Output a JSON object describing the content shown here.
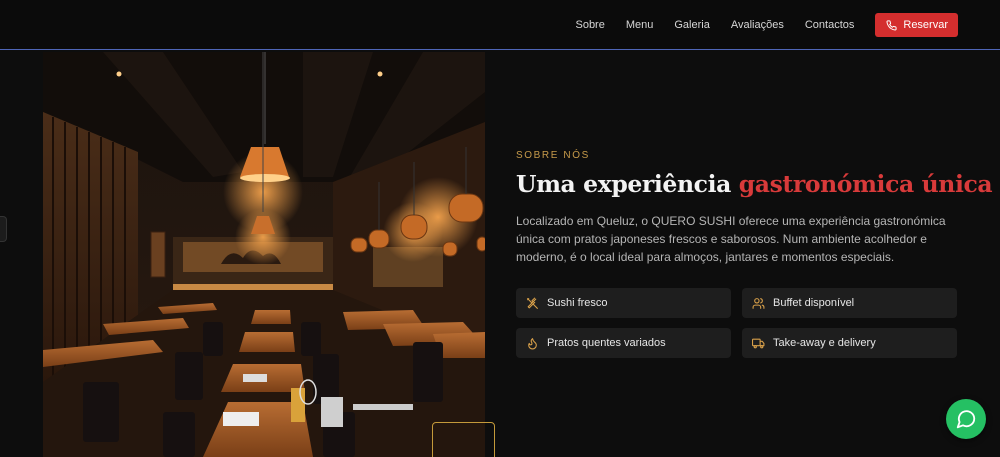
{
  "nav": {
    "links": [
      "Sobre",
      "Menu",
      "Galeria",
      "Avaliações",
      "Contactos"
    ],
    "reserve_label": "Reservar",
    "reserve_icon": "phone-icon"
  },
  "about": {
    "eyebrow": "SOBRE NÓS",
    "heading_main": "Uma experiência",
    "heading_accent": "gastronómica única",
    "description": "Localizado em Queluz, o QUERO SUSHI oferece uma experiência gastronómica única com pratos japoneses frescos e saborosos. Num ambiente acolhedor e moderno, é o local ideal para almoços, jantares e momentos especiais."
  },
  "features": [
    {
      "label": "Sushi fresco",
      "icon": "utensils-crossed-icon"
    },
    {
      "label": "Buffet disponível",
      "icon": "users-icon"
    },
    {
      "label": "Pratos quentes variados",
      "icon": "flame-icon"
    },
    {
      "label": "Take-away e delivery",
      "icon": "truck-icon"
    }
  ],
  "photo": {
    "alt": "restaurant-interior"
  },
  "colors": {
    "accent_red": "#d42e2e",
    "gold": "#c69a4a",
    "whatsapp": "#25c063"
  }
}
